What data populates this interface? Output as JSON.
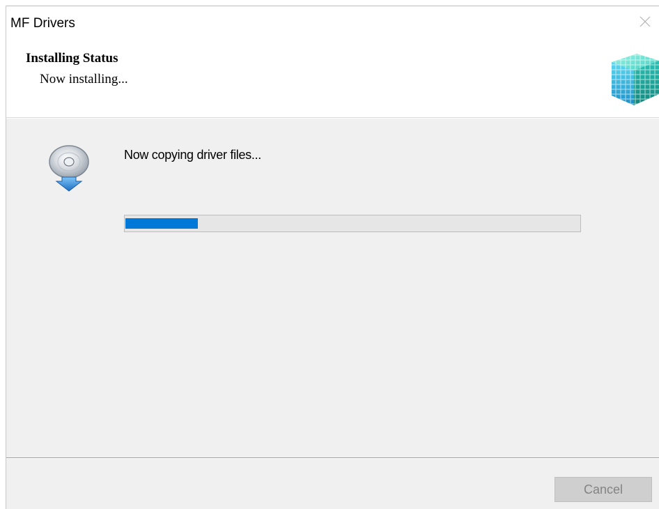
{
  "window": {
    "title": "MF Drivers"
  },
  "header": {
    "title": "Installing Status",
    "subtitle": "Now installing..."
  },
  "main": {
    "status_text": "Now copying driver files...",
    "progress_fraction": 0.16,
    "progress_color": "#0078d7"
  },
  "footer": {
    "cancel_label": "Cancel",
    "cancel_enabled": false
  },
  "icons": {
    "close": "close-icon",
    "logo": "cube-logo-icon",
    "cd": "cd-install-icon"
  }
}
